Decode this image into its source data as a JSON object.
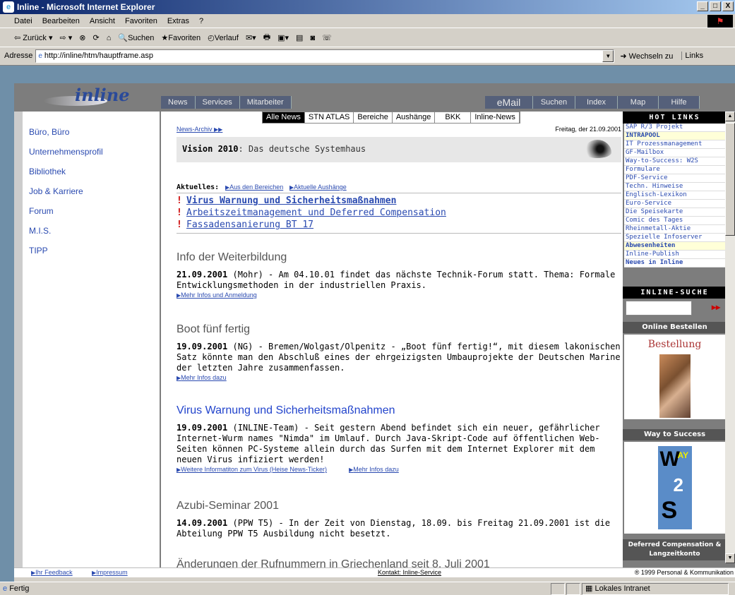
{
  "window": {
    "title": "Inline - Microsoft Internet Explorer",
    "min": "_",
    "max": "□",
    "close": "X"
  },
  "menu": [
    "Datei",
    "Bearbeiten",
    "Ansicht",
    "Favoriten",
    "Extras",
    "?"
  ],
  "toolbar": {
    "back": "⇦ Zurück ▾",
    "forward": "⇨ ▾",
    "stop": "⊗",
    "refresh": "⟳",
    "home": "⌂",
    "search": "Suchen",
    "favorites": "Favoriten",
    "history": "Verlauf",
    "mail": "✉▾",
    "print": "🖶",
    "edit": "▣▾",
    "discuss": "▤",
    "messenger": "◙",
    "extra": "☏"
  },
  "address": {
    "label": "Adresse",
    "url": "http://inline/htm/hauptframe.asp",
    "go": "Wechseln zu",
    "links": "Links"
  },
  "site": {
    "logo": "inline",
    "nav_top": [
      "News",
      "Services",
      "Mitarbeiter"
    ],
    "nav_right": [
      "eMail",
      "Suchen",
      "Index",
      "Map",
      "Hilfe"
    ],
    "sub_nav": [
      "Alle News",
      "STN ATLAS",
      "Bereiche",
      "Aushänge",
      "BKK",
      "Inline-News"
    ],
    "left_menu": [
      "Büro, Büro",
      "Unternehmensprofil",
      "Bibliothek",
      "Job & Karriere",
      "Forum",
      "M.I.S.",
      "TIPP"
    ],
    "archiv": "News-Archiv",
    "date": "Freitag, der 21.09.2001",
    "vision_bold": "Vision 2010",
    "vision_rest": ": Das deutsche Systemhaus",
    "aktuelles_label": "Aktuelles:",
    "aktuelles_links": [
      "Aus den Bereichen",
      "Aktuelle Aushänge"
    ],
    "alerts": [
      "Virus Warnung und Sicherheitsmaßnahmen",
      "Arbeitszeitmanagement und Deferred Compensation",
      "Fassadensanierung BT 17"
    ],
    "articles": [
      {
        "title": "Info der Weiterbildung",
        "date": "21.09.2001",
        "text": " (Mohr) - Am 04.10.01 findet das nächste Technik-Forum statt. Thema: Formale Entwicklungsmethoden in der industriellen Praxis.",
        "links": [
          "Mehr Infos und Anmeldung"
        ]
      },
      {
        "title": "Boot fünf fertig",
        "date": "19.09.2001",
        "text": " (NG) - Bremen/Wolgast/Olpenitz - „Boot fünf fertig!“, mit diesem lakonischen Satz könnte man den Abschluß eines der ehrgeizigsten Umbauprojekte der Deutschen Marine der letzten Jahre zusammenfassen.",
        "links": [
          "Mehr Infos dazu"
        ]
      },
      {
        "title": "Virus Warnung und Sicherheitsmaßnahmen",
        "date": "19.09.2001",
        "text": " (INLINE-Team) - Seit gestern Abend befindet sich ein neuer, gefährlicher Internet-Wurm names \"Nimda\" im Umlauf. Durch Java-Skript-Code auf öffentlichen Web-Seiten können PC-Systeme allein durch das Surfen mit dem Internet Explorer mit dem neuen Virus infiziert werden!",
        "links": [
          "Weitere Informatiton zum Virus (Heise News-Ticker)",
          "Mehr Infos dazu"
        ]
      },
      {
        "title": "Azubi-Seminar 2001",
        "date": "14.09.2001",
        "text": " (PPW T5) - In der Zeit von Dienstag, 18.09. bis Freitag 21.09.2001 ist die Abteilung PPW T5 Ausbildung nicht besetzt.",
        "links": []
      },
      {
        "title": "Änderungen der Rufnummern in Griechenland seit 8. Juli 2001",
        "date": "",
        "text": "",
        "links": []
      }
    ],
    "hot_links_title": "HOT LINKS",
    "hot_links": [
      "SAP R/3 Projekt",
      "INTRAPOOL",
      "IT Prozessmanagement",
      "GF-Mailbox",
      "Way-to-Success: W2S",
      "Formulare",
      "PDF-Service",
      "Techn. Hinweise",
      "Englisch-Lexikon",
      "Euro-Service",
      "Die Speisekarte",
      "Comic des Tages",
      "Rheinmetall-Aktie",
      "Spezielle Infoserver",
      "Abwesenheiten",
      "Inline-Publish",
      "Neues in Inline"
    ],
    "suche_title": "INLINE-SUCHE",
    "suche_go": "▸▸",
    "online_bestellen": "Online Bestellen",
    "bestellung": "Bestellung",
    "way_to_success": "Way to Success",
    "deferred": "Deferred Compensation & Langzeitkonto",
    "footer_feedback": "Ihr Feedback",
    "footer_impressum": "Impressum",
    "footer_contact": "Kontakt: Inline-Service",
    "footer_copy": "® 1999 Personal & Kommunikation"
  },
  "status": {
    "text": "Fertig",
    "zone": "Lokales Intranet"
  }
}
